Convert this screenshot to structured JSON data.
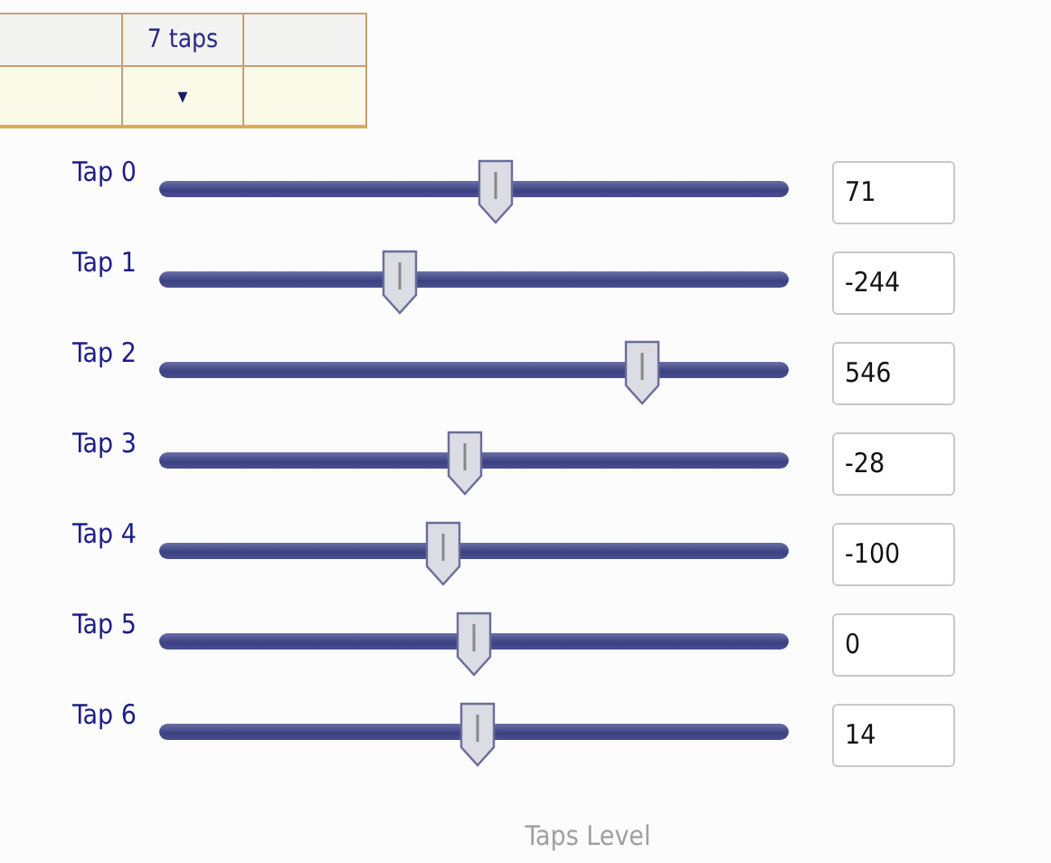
{
  "header": {
    "title": "7 taps",
    "dropdown": "▾"
  },
  "taps": [
    {
      "label": "Tap 0",
      "level": 0.535,
      "value": "71"
    },
    {
      "label": "Tap 1",
      "level": 0.381,
      "value": "-244"
    },
    {
      "label": "Tap 2",
      "level": 0.767,
      "value": "546"
    },
    {
      "label": "Tap 3",
      "level": 0.486,
      "value": "-28"
    },
    {
      "label": "Tap 4",
      "level": 0.451,
      "value": "-100"
    },
    {
      "label": "Tap 5",
      "level": 0.5,
      "value": "0"
    },
    {
      "label": "Tap 6",
      "level": 0.507,
      "value": "14"
    }
  ],
  "caption": "Taps Level"
}
